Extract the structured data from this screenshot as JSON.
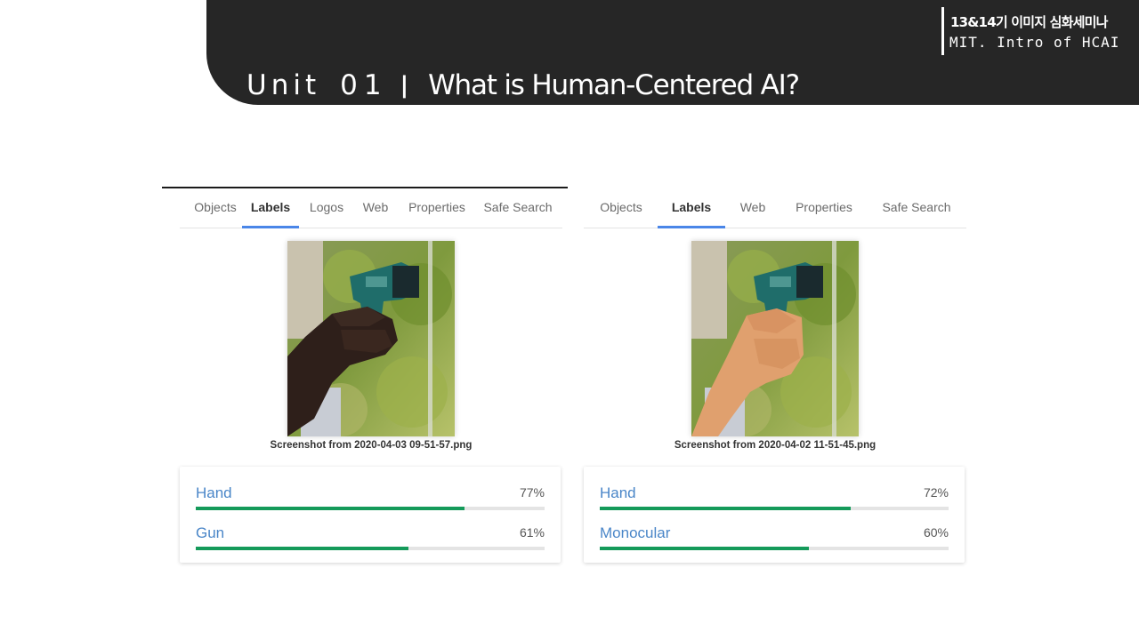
{
  "header": {
    "unit_label": "Unit",
    "unit_number": "01",
    "separator": "|",
    "title": "What is Human-Centered AI?",
    "seminar": "13&14기 이미지 심화세미나",
    "course": "MIT. Intro of HCAI"
  },
  "colors": {
    "banner": "#262626",
    "tab_active": "#4a86e8",
    "progress": "#149a5a",
    "label_link": "#4a86c8"
  },
  "left_panel": {
    "tabs": [
      "Objects",
      "Labels",
      "Logos",
      "Web",
      "Properties",
      "Safe Search"
    ],
    "active_tab": "Labels",
    "caption": "Screenshot from 2020-04-03 09-51-57.png",
    "labels": [
      {
        "name": "Hand",
        "percent": "77%",
        "score": 0.77
      },
      {
        "name": "Gun",
        "percent": "61%",
        "score": 0.61
      }
    ]
  },
  "right_panel": {
    "tabs": [
      "Objects",
      "Labels",
      "Web",
      "Properties",
      "Safe Search"
    ],
    "active_tab": "Labels",
    "caption": "Screenshot from 2020-04-02 11-51-45.png",
    "labels": [
      {
        "name": "Hand",
        "percent": "72%",
        "score": 0.72
      },
      {
        "name": "Monocular",
        "percent": "60%",
        "score": 0.6
      }
    ]
  }
}
